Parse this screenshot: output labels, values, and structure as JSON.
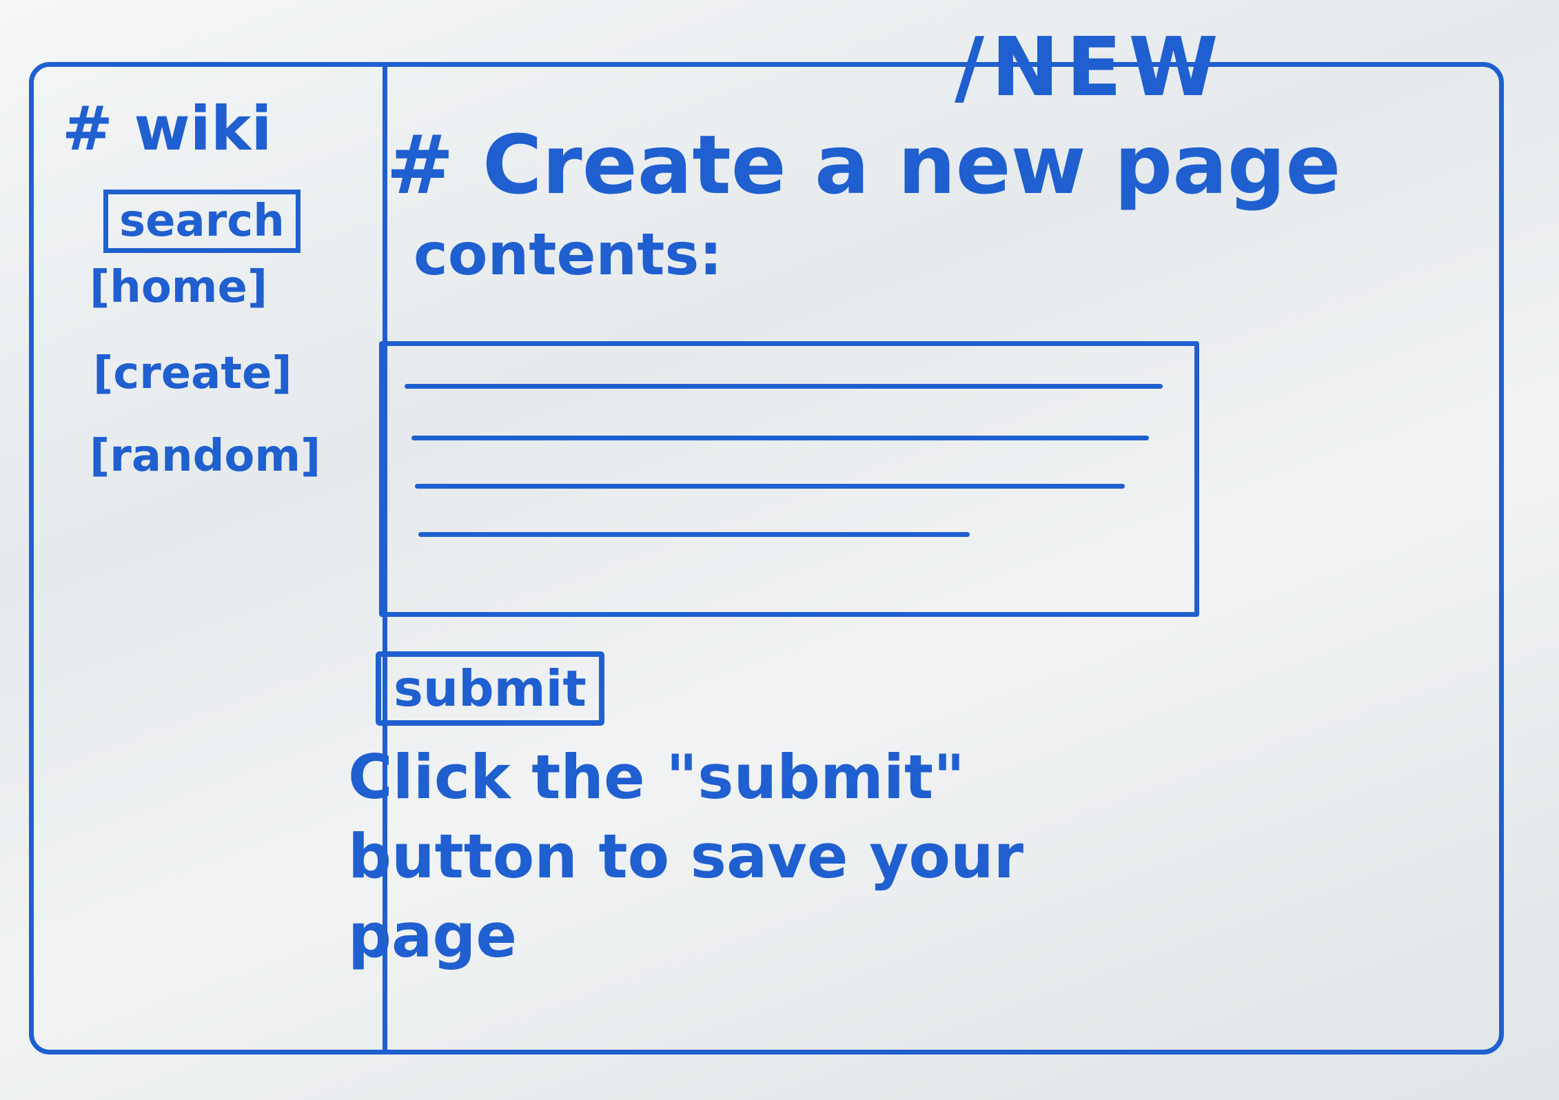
{
  "route": "/NEW",
  "sidebar": {
    "title": "# wiki",
    "search_label": "search",
    "home_label": "[home]",
    "create_label": "[create]",
    "random_label": "[random]"
  },
  "main": {
    "heading": "# Create a new page",
    "contents_label": "contents:",
    "submit_label": "submit",
    "help_line_1": "Click the \"submit\"",
    "help_line_2": "button to save your",
    "help_line_3": "page"
  },
  "colors": {
    "ink": "#1f5fcf",
    "board": "#eef1f2"
  }
}
